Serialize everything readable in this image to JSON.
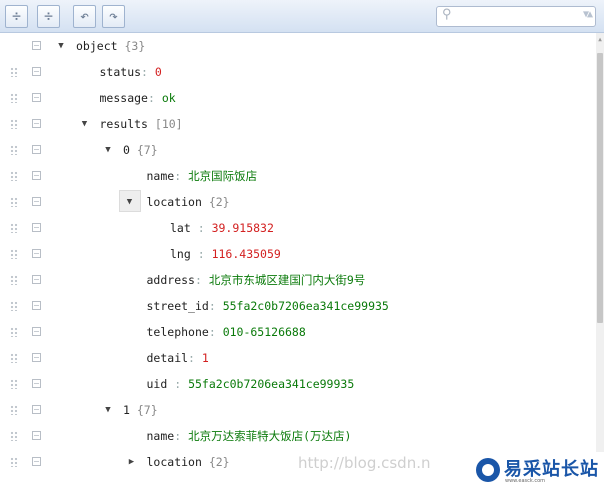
{
  "toolbar": {
    "buttons": [
      {
        "name": "expand-all-button",
        "glyph": "÷"
      },
      {
        "name": "collapse-all-button",
        "glyph": "÷"
      },
      {
        "name": "undo-button",
        "glyph": "↶"
      },
      {
        "name": "redo-button",
        "glyph": "↷"
      }
    ],
    "search": {
      "placeholder": "",
      "icon": "magnifier-icon",
      "dropdown_icon": "▼▲"
    }
  },
  "rows": [
    {
      "indent": 0,
      "toggle": "▼",
      "key": "object",
      "meta": "{3}",
      "value": null
    },
    {
      "indent": 1,
      "toggle": null,
      "key": "status",
      "sep": ":",
      "value": "0",
      "vtype": "num"
    },
    {
      "indent": 1,
      "toggle": null,
      "key": "message",
      "sep": ":",
      "value": "ok",
      "vtype": "str"
    },
    {
      "indent": 1,
      "toggle": "▼",
      "key": "results",
      "meta": "[10]",
      "value": null
    },
    {
      "indent": 2,
      "toggle": "▼",
      "key": "0",
      "meta": "{7}",
      "value": null
    },
    {
      "indent": 3,
      "toggle": null,
      "key": "name",
      "sep": ":",
      "value": "北京国际饭店",
      "vtype": "str"
    },
    {
      "indent": 3,
      "toggle": "▼",
      "boxed": true,
      "key": "location",
      "meta": "{2}",
      "value": null
    },
    {
      "indent": 4,
      "toggle": null,
      "key": "lat",
      "sep": " :",
      "value": "39.915832",
      "vtype": "num"
    },
    {
      "indent": 4,
      "toggle": null,
      "key": "lng",
      "sep": " :",
      "value": "116.435059",
      "vtype": "num"
    },
    {
      "indent": 3,
      "toggle": null,
      "key": "address",
      "sep": ":",
      "value": "北京市东城区建国门内大街9号",
      "vtype": "str"
    },
    {
      "indent": 3,
      "toggle": null,
      "key": "street_id",
      "sep": ":",
      "value": "55fa2c0b7206ea341ce99935",
      "vtype": "str"
    },
    {
      "indent": 3,
      "toggle": null,
      "key": "telephone",
      "sep": ":",
      "value": "010-65126688",
      "vtype": "str"
    },
    {
      "indent": 3,
      "toggle": null,
      "key": "detail",
      "sep": ":",
      "value": "1",
      "vtype": "num"
    },
    {
      "indent": 3,
      "toggle": null,
      "key": "uid",
      "sep": " :",
      "value": "55fa2c0b7206ea341ce99935",
      "vtype": "str"
    },
    {
      "indent": 2,
      "toggle": "▼",
      "key": "1",
      "meta": "{7}",
      "value": null
    },
    {
      "indent": 3,
      "toggle": null,
      "key": "name",
      "sep": ":",
      "value": "北京万达索菲特大饭店(万达店)",
      "vtype": "str"
    },
    {
      "indent": 3,
      "toggle": "▶",
      "key": "location",
      "meta": "{2}",
      "value": null
    }
  ],
  "watermark": "http://blog.csdn.n",
  "logo": {
    "text": "易采站长站",
    "sub": "www.easck.com"
  }
}
